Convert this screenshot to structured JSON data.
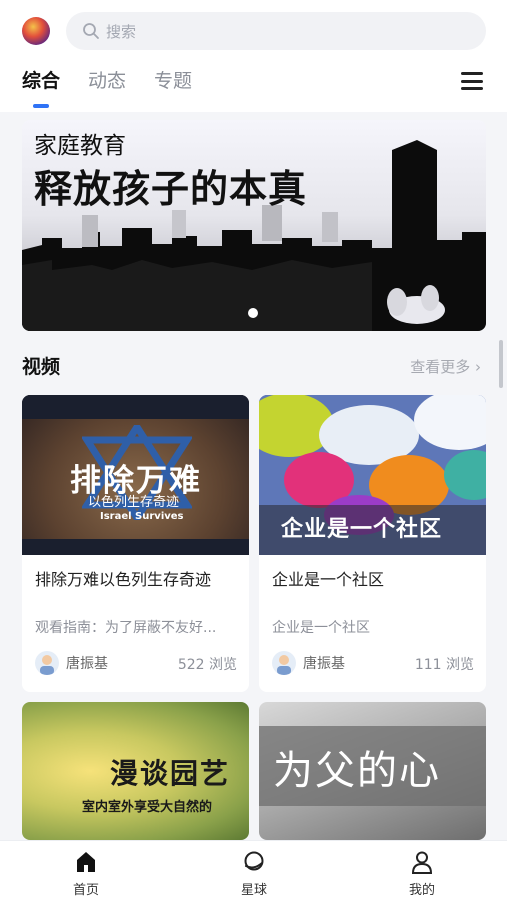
{
  "header": {
    "search_placeholder": "搜索",
    "tabs": [
      {
        "label": "综合"
      },
      {
        "label": "动态"
      },
      {
        "label": "专题"
      }
    ]
  },
  "banner": {
    "kicker": "家庭教育",
    "title": "释放孩子的本真"
  },
  "video_section": {
    "title": "视频",
    "see_more": "查看更多 ›",
    "cards": [
      {
        "thumb_title": "排除万难",
        "thumb_sub": "以色列生存奇迹",
        "thumb_sub_en": "Israel Survives",
        "title": "排除万难以色列生存奇迹",
        "desc": "观看指南：为了屏蔽不友好...",
        "author": "唐振基",
        "views": "522 浏览"
      },
      {
        "thumb_title": "企业是一个社区",
        "title": "企业是一个社区",
        "desc": "企业是一个社区",
        "author": "唐振基",
        "views": "111 浏览"
      },
      {
        "thumb_title": "漫谈园艺",
        "thumb_sub": "室内室外享受大自然的"
      },
      {
        "thumb_title": "为父的心"
      }
    ]
  },
  "bottom_nav": {
    "items": [
      {
        "label": "首页",
        "icon": "home-icon"
      },
      {
        "label": "星球",
        "icon": "planet-icon"
      },
      {
        "label": "我的",
        "icon": "user-icon"
      }
    ]
  },
  "colors": {
    "accent": "#2f73f6",
    "background": "#f4f5f8"
  }
}
